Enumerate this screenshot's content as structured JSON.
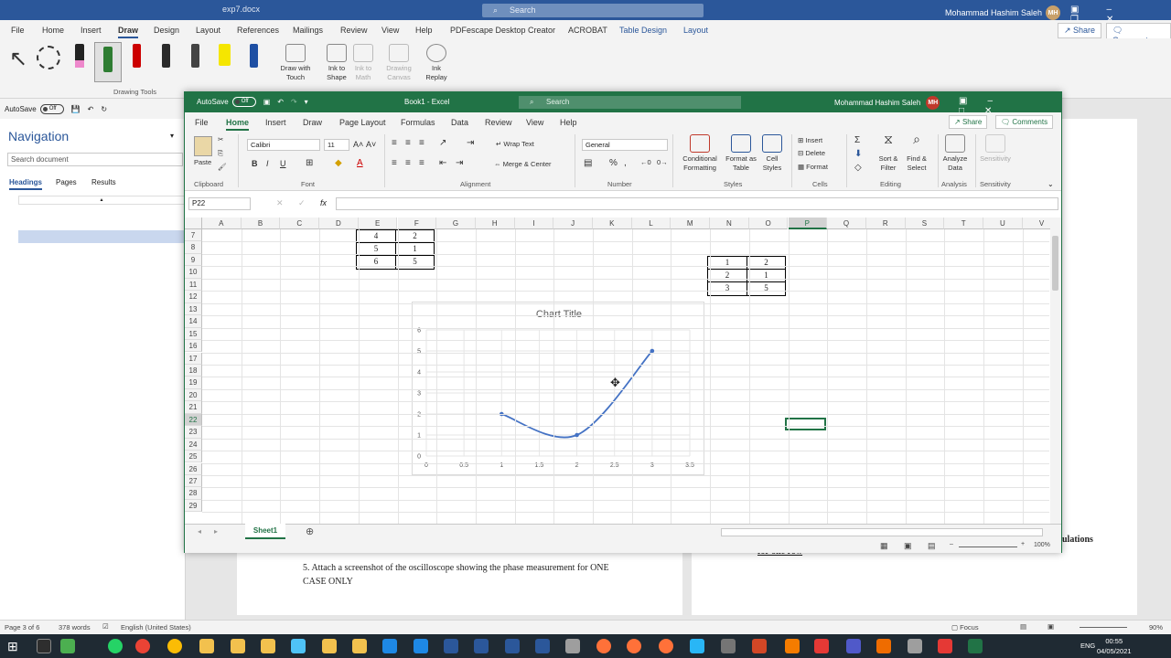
{
  "word": {
    "doc_title": "exp7.docx",
    "search_placeholder": "Search",
    "user_name": "Mohammad Hashim Saleh",
    "user_initials": "MH",
    "tabs": [
      "File",
      "Home",
      "Insert",
      "Draw",
      "Design",
      "Layout",
      "References",
      "Mailings",
      "Review",
      "View",
      "Help",
      "PDFescape Desktop Creator",
      "ACROBAT",
      "Table Design",
      "Layout"
    ],
    "share": "Share",
    "comments": "Comments",
    "ribbon": {
      "draw_with_touch": "Draw with Touch",
      "ink_to_shape": "Ink to Shape",
      "ink_to_math": "Ink to Math",
      "drawing_canvas": "Drawing Canvas",
      "ink_replay": "Ink Replay",
      "group_label": "Drawing Tools"
    },
    "autosave": "AutoSave",
    "autosave_state": "Off",
    "nav": {
      "title": "Navigation",
      "search_placeholder": "Search document",
      "tabs": [
        "Headings",
        "Pages",
        "Results"
      ]
    },
    "doc_text": {
      "item5_line1": "5.  Attach a screenshot of the oscilloscope showing the phase measurement for ONE",
      "item5_line2": "CASE ONLY",
      "right_frag1": "ulations",
      "right_frag2": "for one row"
    },
    "status": {
      "page": "Page 3 of 6",
      "words": "378 words",
      "language": "English (United States)",
      "focus": "Focus",
      "zoom": "90%"
    }
  },
  "excel": {
    "autosave": "AutoSave",
    "autosave_state": "Off",
    "title": "Book1 - Excel",
    "search_placeholder": "Search",
    "user_name": "Mohammad Hashim Saleh",
    "user_initials": "MH",
    "tabs": [
      "File",
      "Home",
      "Insert",
      "Draw",
      "Page Layout",
      "Formulas",
      "Data",
      "Review",
      "View",
      "Help"
    ],
    "share": "Share",
    "comments": "Comments",
    "ribbon": {
      "paste": "Paste",
      "font_name": "Calibri",
      "font_size": "11",
      "wrap_text": "Wrap Text",
      "merge_center": "Merge & Center",
      "number_format": "General",
      "conditional_formatting": "Conditional Formatting",
      "format_as_table": "Format as Table",
      "cell_styles": "Cell Styles",
      "insert": "Insert",
      "delete": "Delete",
      "format": "Format",
      "sort_filter": "Sort & Filter",
      "find_select": "Find & Select",
      "analyze_data": "Analyze Data",
      "sensitivity": "Sensitivity",
      "groups": [
        "Clipboard",
        "Font",
        "Alignment",
        "Number",
        "Styles",
        "Cells",
        "Editing",
        "Analysis",
        "Sensitivity"
      ]
    },
    "name_box": "P22",
    "columns": [
      "A",
      "B",
      "C",
      "D",
      "E",
      "F",
      "G",
      "H",
      "I",
      "J",
      "K",
      "L",
      "M",
      "N",
      "O",
      "P",
      "Q",
      "R",
      "S",
      "T",
      "U",
      "V"
    ],
    "rows": [
      "7",
      "8",
      "9",
      "10",
      "11",
      "12",
      "13",
      "14",
      "15",
      "16",
      "17",
      "18",
      "19",
      "20",
      "21",
      "22",
      "23",
      "24",
      "25",
      "26",
      "27",
      "28",
      "29"
    ],
    "table1": [
      [
        "4",
        "2"
      ],
      [
        "5",
        "1"
      ],
      [
        "6",
        "5"
      ]
    ],
    "table2": [
      [
        "1",
        "2"
      ],
      [
        "2",
        "1"
      ],
      [
        "3",
        "5"
      ]
    ],
    "sheet_tab": "Sheet1",
    "zoom": "100%"
  },
  "chart_data": {
    "type": "scatter",
    "title": "Chart Title",
    "smooth": true,
    "series": [
      {
        "x": [
          1,
          2,
          3
        ],
        "y": [
          2,
          1,
          5
        ]
      }
    ],
    "xlim": [
      0,
      3.5
    ],
    "ylim": [
      0,
      6
    ],
    "xticks": [
      "0",
      "0.5",
      "1",
      "1.5",
      "2",
      "2.5",
      "3",
      "3.5"
    ],
    "yticks": [
      "0",
      "1",
      "2",
      "3",
      "4",
      "5",
      "6"
    ],
    "grid": true,
    "line_color": "#4472c4"
  },
  "taskbar": {
    "language": "ENG",
    "time": "00:55",
    "date": "04/05/2021"
  }
}
